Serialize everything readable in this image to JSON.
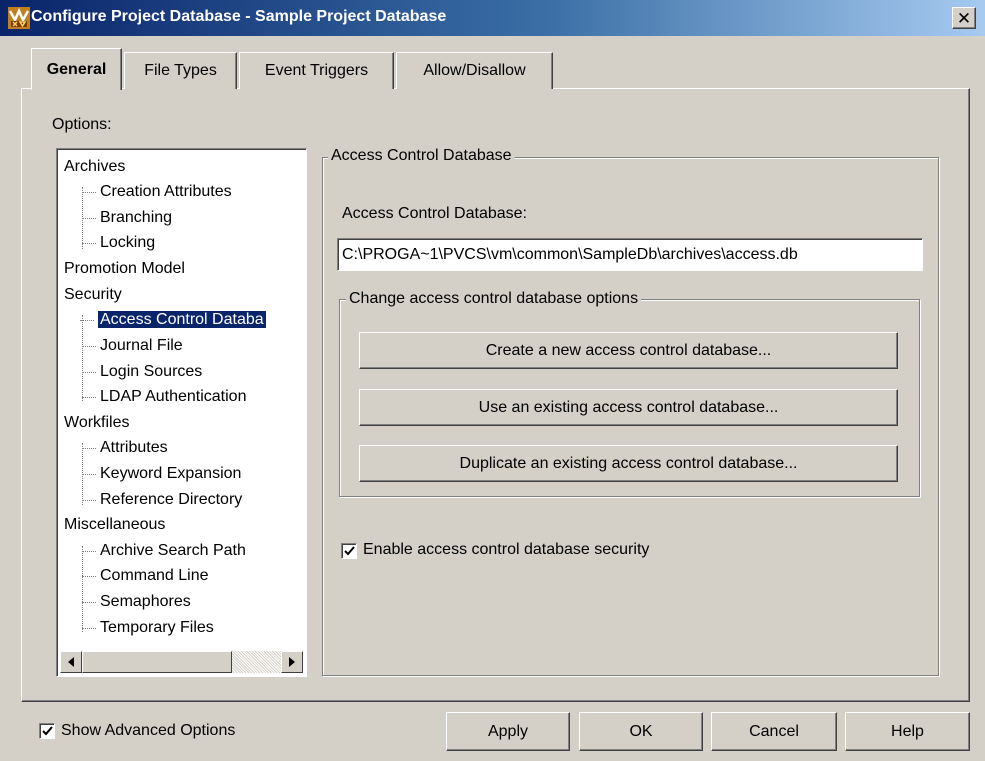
{
  "window": {
    "title": "Configure Project Database - Sample Project Database",
    "close_glyph": "✕"
  },
  "tabs": [
    {
      "label": "General",
      "active": true
    },
    {
      "label": "File Types",
      "active": false
    },
    {
      "label": "Event Triggers",
      "active": false
    },
    {
      "label": "Allow/Disallow",
      "active": false
    }
  ],
  "options_label": "Options:",
  "tree": {
    "items": [
      {
        "label": "Archives",
        "level": 0
      },
      {
        "label": "Creation Attributes",
        "level": 1
      },
      {
        "label": "Branching",
        "level": 1
      },
      {
        "label": "Locking",
        "level": 1
      },
      {
        "label": "Promotion Model",
        "level": 0
      },
      {
        "label": "Security",
        "level": 0
      },
      {
        "label": "Access Control Databa",
        "level": 1,
        "selected": true
      },
      {
        "label": "Journal File",
        "level": 1
      },
      {
        "label": "Login Sources",
        "level": 1
      },
      {
        "label": "LDAP Authentication",
        "level": 1
      },
      {
        "label": "Workfiles",
        "level": 0
      },
      {
        "label": "Attributes",
        "level": 1
      },
      {
        "label": "Keyword Expansion",
        "level": 1
      },
      {
        "label": "Reference Directory",
        "level": 1
      },
      {
        "label": "Miscellaneous",
        "level": 0
      },
      {
        "label": "Archive Search Path",
        "level": 1
      },
      {
        "label": "Command Line",
        "level": 1
      },
      {
        "label": "Semaphores",
        "level": 1
      },
      {
        "label": "Temporary Files",
        "level": 1
      }
    ]
  },
  "access_control": {
    "group_title": "Access Control Database",
    "field_label": "Access Control Database:",
    "path_value": "C:\\PROGA~1\\PVCS\\vm\\common\\SampleDb\\archives\\access.db",
    "options_group_title": "Change access control database options",
    "create_button": "Create a new access control database...",
    "use_existing_button": "Use an existing access control database...",
    "duplicate_button": "Duplicate an existing access control database...",
    "enable_security_label": "Enable access control database security",
    "enable_security_checked": true
  },
  "footer": {
    "show_advanced_label": "Show Advanced Options",
    "show_advanced_checked": true,
    "apply": "Apply",
    "ok": "OK",
    "cancel": "Cancel",
    "help": "Help"
  },
  "colors": {
    "titlebar_start": "#0a246a",
    "titlebar_end": "#a6caf0",
    "selection": "#0a246a",
    "face": "#d4d0c8"
  }
}
